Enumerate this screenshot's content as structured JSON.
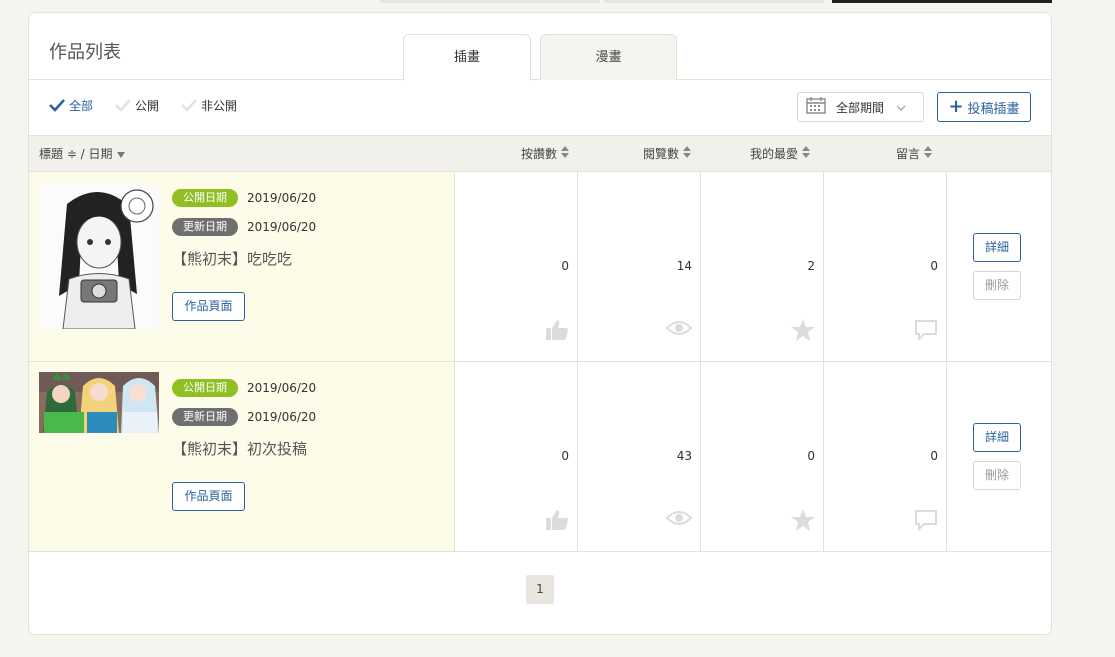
{
  "header": {
    "title": "作品列表",
    "tabs": [
      {
        "label": "插畫",
        "active": true
      },
      {
        "label": "漫畫",
        "active": false
      }
    ]
  },
  "filters": [
    {
      "label": "全部",
      "checked": true
    },
    {
      "label": "公開",
      "checked": false
    },
    {
      "label": "非公開",
      "checked": false
    }
  ],
  "period": {
    "label": "全部期間",
    "icon": "calendar-icon"
  },
  "post_button": {
    "label": "投稿插畫",
    "icon": "plus-icon"
  },
  "table": {
    "headers": {
      "title_date": "標題 ≑ / 日期",
      "likes": "按讚數",
      "views": "閱覽數",
      "favorites": "我的最愛",
      "comments": "留言"
    },
    "rows": [
      {
        "publish_badge": "公開日期",
        "publish_date": "2019/06/20",
        "update_badge": "更新日期",
        "update_date": "2019/06/20",
        "title": "【熊初末】吃吃吃",
        "page_button": "作品頁面",
        "likes": "0",
        "views": "14",
        "favorites": "2",
        "comments": "0",
        "detail_button": "詳細",
        "delete_button": "刪除"
      },
      {
        "publish_badge": "公開日期",
        "publish_date": "2019/06/20",
        "update_badge": "更新日期",
        "update_date": "2019/06/20",
        "title": "【熊初末】初次投稿",
        "page_button": "作品頁面",
        "likes": "0",
        "views": "43",
        "favorites": "0",
        "comments": "0",
        "detail_button": "詳細",
        "delete_button": "刪除"
      }
    ]
  },
  "pagination": {
    "current": "1"
  },
  "colors": {
    "accent": "#2a63a3",
    "badge_published": "#8fbf22",
    "badge_updated": "#6f6f6f",
    "row_highlight": "#fdfce8",
    "header_bg": "#f2f0ea"
  }
}
